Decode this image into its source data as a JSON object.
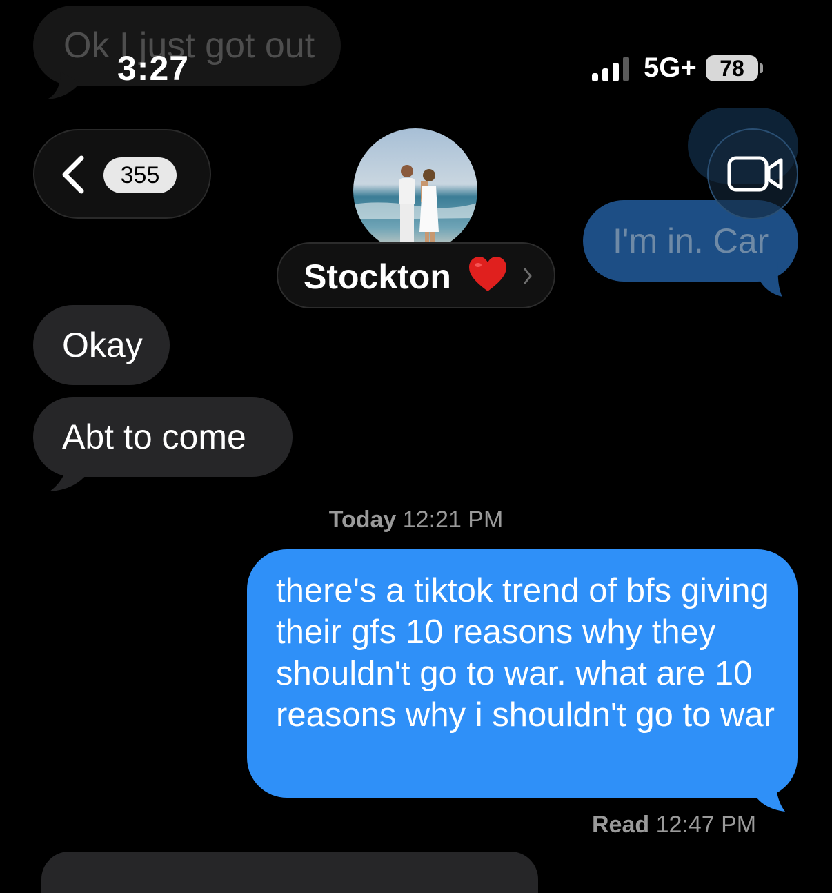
{
  "status_bar": {
    "time": "3:27",
    "network": "5G+",
    "battery": "78"
  },
  "header": {
    "back_count": "355",
    "contact_name": "Stockton",
    "contact_emoji": "red-heart-icon",
    "video_icon": "video-camera-icon"
  },
  "background_messages": {
    "received": "Ok I just got out",
    "sent": "I'm in. Car"
  },
  "messages": [
    {
      "direction": "received",
      "text": "Okay"
    },
    {
      "direction": "received",
      "text": "Abt to come"
    },
    {
      "direction": "sent",
      "text": "there's a tiktok trend of bfs giving their gfs 10 reasons why they shouldn't go to war. what are 10 reasons why i shouldn't go to war"
    }
  ],
  "timestamp": {
    "day": "Today",
    "time": "12:21 PM"
  },
  "receipt": {
    "label": "Read",
    "time": "12:47 PM"
  },
  "colors": {
    "sent_bubble": "#2f90f8",
    "received_bubble": "#262628",
    "background": "#000000"
  }
}
